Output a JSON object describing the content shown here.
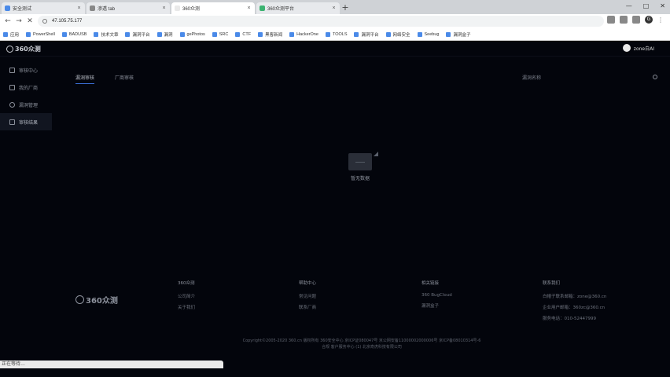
{
  "browser": {
    "tabs": [
      {
        "label": "安全测试",
        "favicon_color": "#4a8ae8",
        "active": false
      },
      {
        "label": "渗透 tab",
        "favicon_color": "#888888",
        "active": false
      },
      {
        "label": "360众测",
        "favicon_color": "#e9e9e9",
        "active": true
      },
      {
        "label": "360众测平台",
        "favicon_color": "#3cb371",
        "active": false
      }
    ],
    "new_tab": "+",
    "window_controls": [
      "—",
      "□",
      "✕"
    ],
    "back": "←",
    "forward": "→",
    "reload": "✕",
    "address": "47.105.75.177",
    "bookmarks": [
      "应用",
      "PowerShell",
      "BADUSB",
      "技术文章",
      "漏洞平台",
      "漏洞",
      "gePhotos",
      "SRC",
      "CTF",
      "黑客新闻",
      "HackerOne",
      "TOOLS",
      "漏洞平台",
      "网络安全",
      "Seebug",
      "漏洞盒子"
    ]
  },
  "app": {
    "brand": "360众测",
    "username": "zone白AI",
    "sidebar": [
      {
        "label": "审核中心",
        "icon": "home-icon",
        "active": false
      },
      {
        "label": "我的厂商",
        "icon": "document-icon",
        "active": false
      },
      {
        "label": "漏洞管理",
        "icon": "gear-icon",
        "active": false
      },
      {
        "label": "审核结果",
        "icon": "folder-icon",
        "active": true
      }
    ],
    "tabs": [
      {
        "label": "漏洞审核",
        "active": true
      },
      {
        "label": "厂商审核",
        "active": false
      }
    ],
    "search": {
      "label": "漏洞名称",
      "placeholder": "",
      "icon": "search-icon"
    },
    "empty_state": "暂无数据"
  },
  "footer": {
    "brand": "360众测",
    "columns": [
      {
        "heading": "360众测",
        "links": [
          "公司简介",
          "关于我们"
        ]
      },
      {
        "heading": "帮助中心",
        "links": [
          "常见问题",
          "联系厂商"
        ]
      },
      {
        "heading": "相关链接",
        "links": [
          "360 BugCloud",
          "漏洞盒子"
        ]
      },
      {
        "heading": "联系我们",
        "links": [
          "白帽子联系邮箱：zone@360.cn",
          "企业用户邮箱：360zc@360.cn",
          "服务电话：010-52447999"
        ]
      }
    ],
    "copyright_lines": [
      "Copyright©2005-2020 360.cn 版权所有 360安全中心 京ICP证080047号 京公网安备11000002000006号 京ICP备08010314号-6",
      "合规 客户服务中心 (1) 北京奇虎科技有限公司"
    ]
  },
  "status_bar": "正在等待…"
}
